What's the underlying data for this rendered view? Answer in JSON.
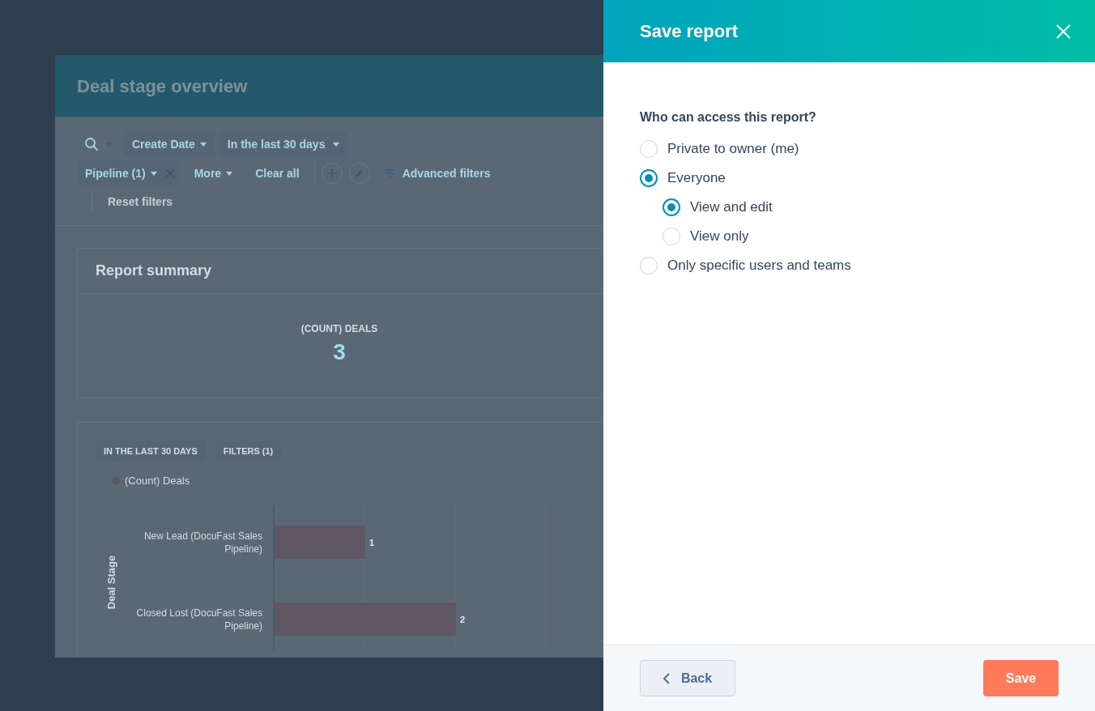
{
  "report": {
    "title": "Deal stage overview",
    "filters": {
      "date_property": "Create Date",
      "date_range": "In the last 30 days",
      "pipeline": "Pipeline (1)",
      "more": "More",
      "clear": "Clear all",
      "advanced": "Advanced filters",
      "reset": "Reset filters"
    },
    "summary": {
      "title": "Report summary",
      "metric_label": "(COUNT) DEALS",
      "metric_value": "3"
    },
    "chart_card": {
      "tags": [
        "IN THE LAST 30 DAYS",
        "FILTERS (1)"
      ],
      "chart_data": {
        "type": "bar",
        "orientation": "horizontal",
        "ylabel": "Deal Stage",
        "categories": [
          "New Lead (DocuFast Sales Pipeline)",
          "Closed Lost (DocuFast Sales Pipeline)"
        ],
        "series": [
          {
            "name": "(Count) Deals",
            "color": "#5e5663",
            "values": [
              1,
              2
            ]
          }
        ],
        "data_labels": true
      }
    }
  },
  "panel": {
    "title": "Save report",
    "question": "Who can access this report?",
    "options": [
      {
        "label": "Private to owner (me)",
        "selected": false
      },
      {
        "label": "Everyone",
        "selected": true,
        "children": [
          {
            "label": "View and edit",
            "selected": true
          },
          {
            "label": "View only",
            "selected": false
          }
        ]
      },
      {
        "label": "Only specific users and teams",
        "selected": false
      }
    ],
    "back": "Back",
    "save": "Save"
  }
}
